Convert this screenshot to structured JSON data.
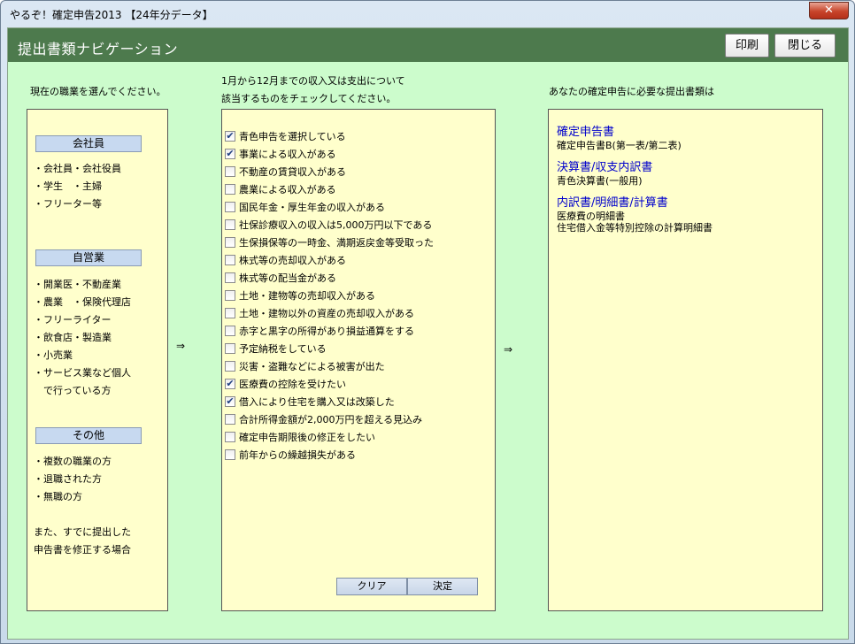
{
  "window": {
    "title": "やるぞ！確定申告2013 【24年分データ】",
    "close_label": "✕"
  },
  "header": {
    "title": "提出書類ナビゲーション",
    "print_label": "印刷",
    "close_label": "閉じる"
  },
  "left": {
    "caption": "現在の職業を選んでください。",
    "categories": [
      {
        "label": "会社員",
        "items": [
          "・会社員・会社役員",
          "・学生　・主婦",
          "・フリーター等"
        ]
      },
      {
        "label": "自営業",
        "items": [
          "・開業医・不動産業",
          "・農業　・保険代理店",
          "・フリーライター",
          "・飲食店・製造業",
          "・小売業",
          "・サービス業など個人",
          "　で行っている方"
        ]
      },
      {
        "label": "その他",
        "items": [
          "・複数の職業の方",
          "・退職された方",
          "・無職の方"
        ]
      }
    ],
    "note_line1": "また、すでに提出した",
    "note_line2": "申告書を修正する場合"
  },
  "arrows": {
    "left": "⇒",
    "right": "⇒"
  },
  "middle": {
    "caption_line1": "1月から12月までの収入又は支出について",
    "caption_line2": "該当するものをチェックしてください。",
    "checks": [
      {
        "label": "青色申告を選択している",
        "checked": true
      },
      {
        "label": "事業による収入がある",
        "checked": true
      },
      {
        "label": "不動産の賃貸収入がある",
        "checked": false
      },
      {
        "label": "農業による収入がある",
        "checked": false
      },
      {
        "label": "国民年金・厚生年金の収入がある",
        "checked": false
      },
      {
        "label": "社保診療収入の収入は5,000万円以下である",
        "checked": false
      },
      {
        "label": "生保損保等の一時金、満期返戻金等受取った",
        "checked": false
      },
      {
        "label": "株式等の売却収入がある",
        "checked": false
      },
      {
        "label": "株式等の配当金がある",
        "checked": false
      },
      {
        "label": "土地・建物等の売却収入がある",
        "checked": false
      },
      {
        "label": "土地・建物以外の資産の売却収入がある",
        "checked": false
      },
      {
        "label": "赤字と黒字の所得があり損益通算をする",
        "checked": false
      },
      {
        "label": "予定納税をしている",
        "checked": false
      },
      {
        "label": "災害・盗難などによる被害が出た",
        "checked": false
      },
      {
        "label": "医療費の控除を受けたい",
        "checked": true
      },
      {
        "label": "借入により住宅を購入又は改築した",
        "checked": true
      },
      {
        "label": "合計所得金額が2,000万円を超える見込み",
        "checked": false
      },
      {
        "label": "確定申告期限後の修正をしたい",
        "checked": false
      },
      {
        "label": "前年からの繰越損失がある",
        "checked": false
      }
    ],
    "check_mark": "✔",
    "clear_label": "クリア",
    "decide_label": "決定"
  },
  "right": {
    "caption": "あなたの確定申告に必要な提出書類は",
    "groups": [
      {
        "title": "確定申告書",
        "items": [
          "確定申告書B(第一表/第二表)"
        ]
      },
      {
        "title": "決算書/収支内訳書",
        "items": [
          "青色決算書(一般用)"
        ]
      },
      {
        "title": "内訳書/明細書/計算書",
        "items": [
          "医療費の明細書",
          "住宅借入金等特別控除の計算明細書"
        ]
      }
    ]
  }
}
